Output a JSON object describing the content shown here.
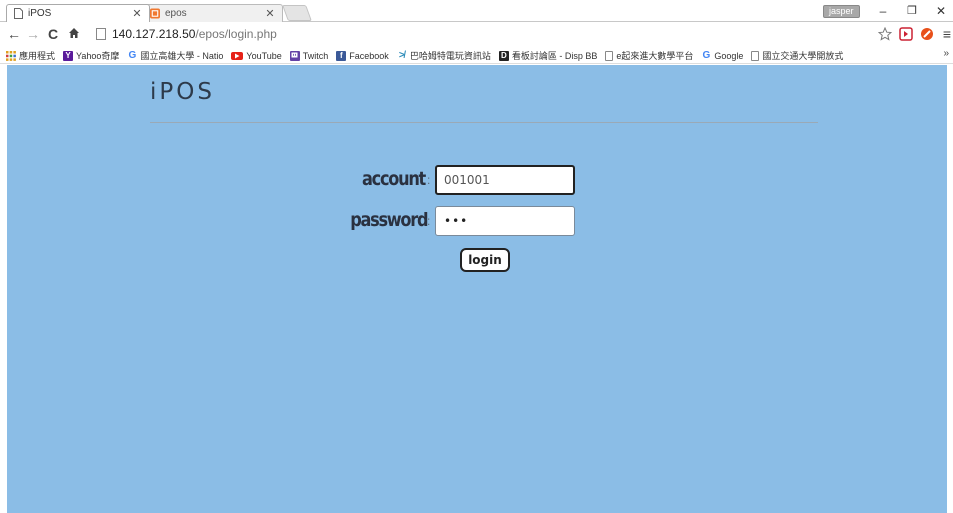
{
  "browser": {
    "tabs": [
      {
        "title": "iPOS",
        "active": true
      },
      {
        "title": "epos",
        "active": false
      }
    ],
    "user": "jasper",
    "window_controls": {
      "minimize": "–",
      "restore": "❐",
      "close": "✕"
    },
    "url": {
      "host": "140.127.218.50",
      "path": "/epos/login.php"
    },
    "bookmarks": [
      {
        "label": "應用程式",
        "icon": "apps-icon",
        "color": "#e0a020"
      },
      {
        "label": "Yahoo奇摩",
        "icon": "yahoo-icon",
        "color": "#5a1a9a"
      },
      {
        "label": "國立高雄大學 - Natio",
        "icon": "google-icon",
        "color": "#4285f4"
      },
      {
        "label": "YouTube",
        "icon": "youtube-icon",
        "color": "#e62117"
      },
      {
        "label": "Twitch",
        "icon": "twitch-icon",
        "color": "#6441a5"
      },
      {
        "label": "Facebook",
        "icon": "facebook-icon",
        "color": "#3b5998"
      },
      {
        "label": "巴哈姆特電玩資訊站",
        "icon": "bahamut-icon",
        "color": "#2a8ab8"
      },
      {
        "label": "看板討論區 - Disp BB",
        "icon": "dispbbs-icon",
        "color": "#222222"
      },
      {
        "label": "e起來進大數學平台",
        "icon": "page-icon",
        "color": "#888888"
      },
      {
        "label": "Google",
        "icon": "google-icon",
        "color": "#4285f4"
      },
      {
        "label": "國立交通大學開放式",
        "icon": "page-icon",
        "color": "#888888"
      }
    ],
    "bookmarks_overflow": "»"
  },
  "page": {
    "logo": "iPOS",
    "account_label": "account",
    "account_sep": ":",
    "account_value": "001001",
    "password_label": "password",
    "password_sep": ":",
    "password_value": "•••",
    "login_label": "login",
    "background_color": "#8bbde6"
  }
}
